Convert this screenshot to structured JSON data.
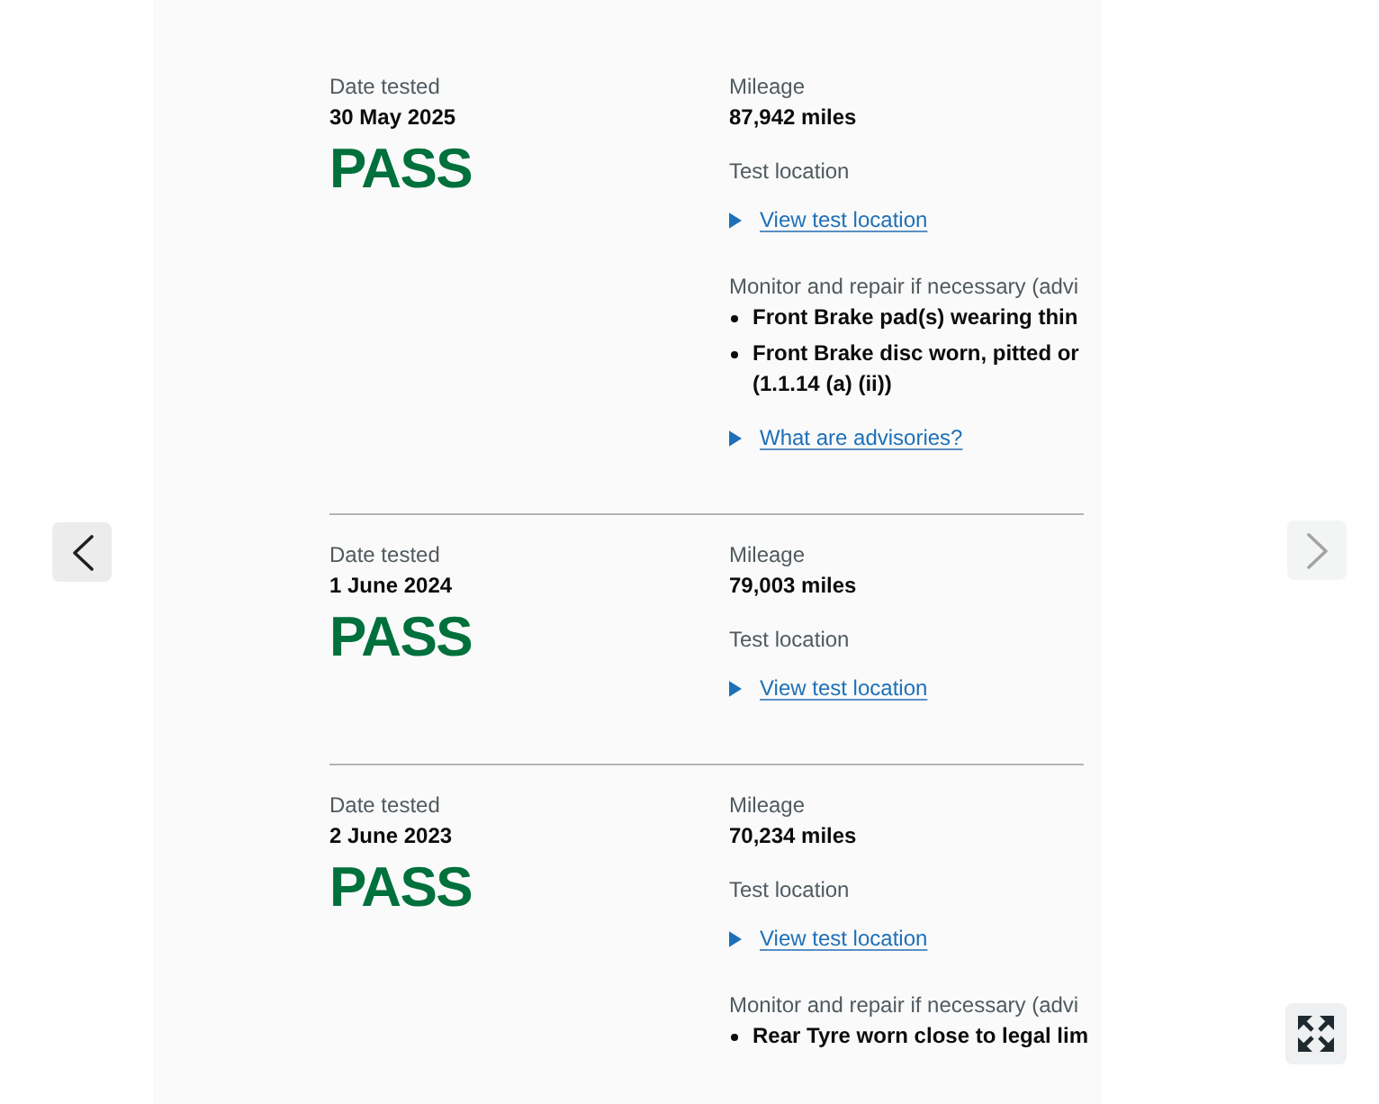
{
  "viewer": {
    "navigation": [
      {
        "kind": "previous",
        "disabled": false
      },
      {
        "kind": "next",
        "disabled": true
      }
    ]
  },
  "records": [
    {
      "date_label": "Date tested",
      "date": "30 May 2025",
      "result": "PASS",
      "mileage_label": "Mileage",
      "mileage": "87,942 miles",
      "location_label": "Test location",
      "location_toggle": {
        "label": "View test location",
        "expanded": false
      },
      "advisories": {
        "heading": "Monitor and repair if necessary (advi",
        "items": [
          {
            "lines": [
              "Front Brake pad(s) wearing thin"
            ]
          },
          {
            "lines": [
              "Front Brake disc worn, pitted or",
              "(1.1.14 (a) (ii))"
            ]
          }
        ],
        "help_toggle": {
          "label": "What are advisories?",
          "expanded": false
        }
      }
    },
    {
      "date_label": "Date tested",
      "date": "1 June 2024",
      "result": "PASS",
      "mileage_label": "Mileage",
      "mileage": "79,003 miles",
      "location_label": "Test location",
      "location_toggle": {
        "label": "View test location",
        "expanded": false
      }
    },
    {
      "date_label": "Date tested",
      "date": "2 June 2023",
      "result": "PASS",
      "mileage_label": "Mileage",
      "mileage": "70,234 miles",
      "location_label": "Test location",
      "location_toggle": {
        "label": "View test location",
        "expanded": false
      },
      "advisories": {
        "heading": "Monitor and repair if necessary (advi",
        "items": [
          {
            "lines": [
              "Rear Tyre worn close to legal lim"
            ]
          }
        ]
      }
    }
  ]
}
